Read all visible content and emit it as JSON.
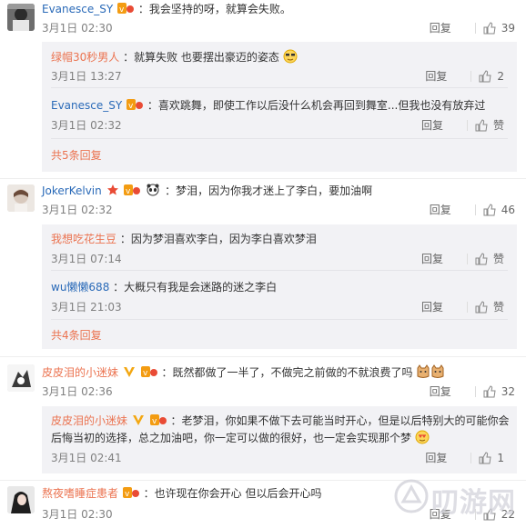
{
  "actions": {
    "reply": "回复",
    "like": "赞"
  },
  "comments": [
    {
      "user": "Evanesce_SY",
      "text": "：我会坚持的呀，就算会失败。",
      "time": "3月1日 02:30",
      "likes": "39",
      "replies": [
        {
          "user": "绿帽30秒男人",
          "text": "：就算失败 也要摆出豪迈的姿态",
          "time": "3月1日 13:27",
          "likes": "2"
        },
        {
          "user": "Evanesce_SY",
          "text": "：喜欢跳舞，即使工作以后没什么机会再回到舞室...但我也没有放弃过",
          "time": "3月1日 02:32",
          "likes": "赞"
        }
      ],
      "more": "共5条回复"
    },
    {
      "user": "JokerKelvin",
      "text": "：梦泪，因为你我才迷上了李白，要加油啊",
      "time": "3月1日 02:32",
      "likes": "46",
      "replies": [
        {
          "user": "我想吃花生豆",
          "text": "：因为梦泪喜欢李白，因为李白喜欢梦泪",
          "time": "3月1日 07:14",
          "likes": "赞"
        },
        {
          "user": "wu懒懒688",
          "text": "：大概只有我是会迷路的迷之李白",
          "time": "3月1日 21:03",
          "likes": "赞"
        }
      ],
      "more": "共4条回复"
    },
    {
      "user": "皮皮泪的小迷妹",
      "text": "：既然都做了一半了，不做完之前做的不就浪费了吗",
      "time": "3月1日 02:36",
      "likes": "32",
      "replies": [
        {
          "user": "皮皮泪的小迷妹",
          "text1": "：老梦泪，你如果不做下去可能当时开心，但是以后特别大的可能你会",
          "text2": "后悔当初的选择，总之加油吧，你一定可以做的很好，也一定会实现那个梦",
          "time": "3月1日 02:41",
          "likes": "1"
        }
      ]
    },
    {
      "user": "熬夜嗜睡症患者",
      "text": "：也许现在你会开心 但以后会开心吗",
      "time": "3月1日 02:30",
      "likes": "22"
    }
  ],
  "watermark": "叨游网"
}
